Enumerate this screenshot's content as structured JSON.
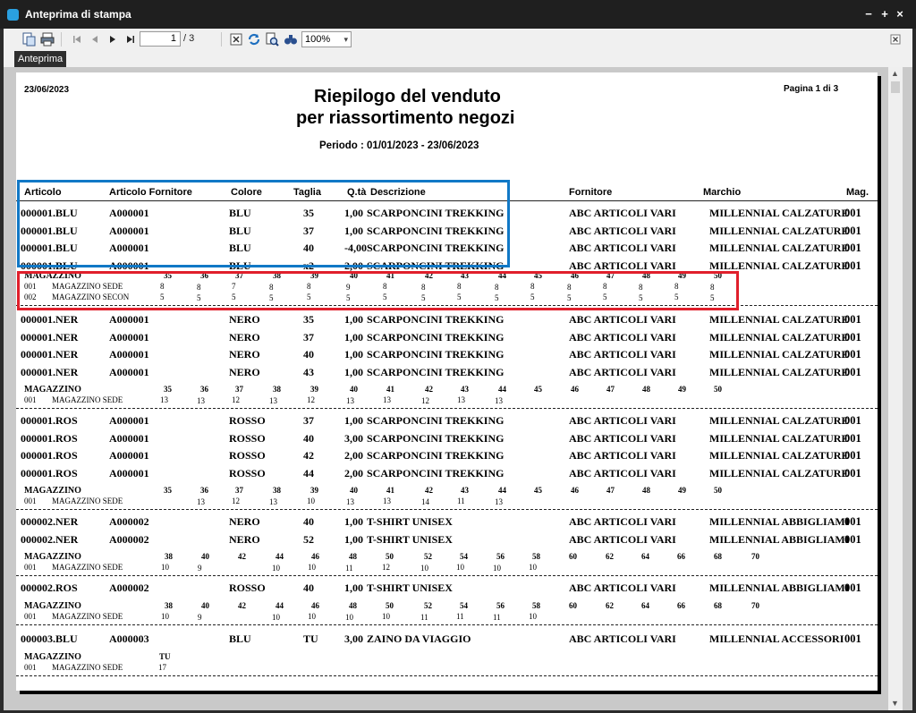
{
  "window": {
    "title": "Anteprima di stampa",
    "controls": [
      "−",
      "+",
      "×"
    ]
  },
  "toolbar": {
    "page_current": "1",
    "page_total": "/ 3",
    "zoom": "100%",
    "tooltip": "Anteprima"
  },
  "report": {
    "date": "23/06/2023",
    "title_line1": "Riepilogo del venduto",
    "title_line2": "per riassortimento negozi",
    "period": "Periodo : 01/01/2023 - 23/06/2023",
    "page_info": "Pagina 1 di 3",
    "headers": {
      "articolo": "Articolo",
      "articolo_fornitore": "Articolo Fornitore",
      "colore": "Colore",
      "taglia": "Taglia",
      "qta": "Q.tà",
      "descrizione": "Descrizione",
      "fornitore": "Fornitore",
      "marchio": "Marchio",
      "mag": "Mag."
    },
    "groups": [
      {
        "rows": [
          {
            "articolo": "000001.BLU",
            "forn_art": "A000001",
            "colore": "BLU",
            "taglia": "35",
            "qta": "1,00",
            "desc": "SCARPONCINI TREKKING",
            "fornitore": "ABC ARTICOLI VARI",
            "marchio": "MILLENNIAL CALZATURE",
            "mag": "001"
          },
          {
            "articolo": "000001.BLU",
            "forn_art": "A000001",
            "colore": "BLU",
            "taglia": "37",
            "qta": "1,00",
            "desc": "SCARPONCINI TREKKING",
            "fornitore": "ABC ARTICOLI VARI",
            "marchio": "MILLENNIAL CALZATURE",
            "mag": "001"
          },
          {
            "articolo": "000001.BLU",
            "forn_art": "A000001",
            "colore": "BLU",
            "taglia": "40",
            "qta": "-4,00",
            "desc": "SCARPONCINI TREKKING",
            "fornitore": "ABC ARTICOLI VARI",
            "marchio": "MILLENNIAL CALZATURE",
            "mag": "001"
          },
          {
            "articolo": "000001.BLU",
            "forn_art": "A000001",
            "colore": "BLU",
            "taglia": "x2",
            "qta": "2,00",
            "desc": "SCARPONCINI TREKKING",
            "fornitore": "ABC ARTICOLI VARI",
            "marchio": "MILLENNIAL CALZATURE",
            "mag": "001"
          }
        ],
        "mag_label": "MAGAZZINO",
        "sizes": [
          "35",
          "36",
          "37",
          "38",
          "39",
          "40",
          "41",
          "42",
          "43",
          "44",
          "45",
          "46",
          "47",
          "48",
          "49",
          "50"
        ],
        "stock": [
          {
            "code": "001",
            "name": "MAGAZZINO SEDE",
            "values": [
              "8",
              "8",
              "7",
              "8",
              "8",
              "9",
              "8",
              "8",
              "8",
              "8",
              "8",
              "8",
              "8",
              "8",
              "8",
              "8"
            ]
          },
          {
            "code": "002",
            "name": "MAGAZZINO SECON",
            "values": [
              "5",
              "5",
              "5",
              "5",
              "5",
              "5",
              "5",
              "5",
              "5",
              "5",
              "5",
              "5",
              "5",
              "5",
              "5",
              "5"
            ]
          }
        ]
      },
      {
        "rows": [
          {
            "articolo": "000001.NER",
            "forn_art": "A000001",
            "colore": "NERO",
            "taglia": "35",
            "qta": "1,00",
            "desc": "SCARPONCINI TREKKING",
            "fornitore": "ABC ARTICOLI VARI",
            "marchio": "MILLENNIAL CALZATURE",
            "mag": "001"
          },
          {
            "articolo": "000001.NER",
            "forn_art": "A000001",
            "colore": "NERO",
            "taglia": "37",
            "qta": "1,00",
            "desc": "SCARPONCINI TREKKING",
            "fornitore": "ABC ARTICOLI VARI",
            "marchio": "MILLENNIAL CALZATURE",
            "mag": "001"
          },
          {
            "articolo": "000001.NER",
            "forn_art": "A000001",
            "colore": "NERO",
            "taglia": "40",
            "qta": "1,00",
            "desc": "SCARPONCINI TREKKING",
            "fornitore": "ABC ARTICOLI VARI",
            "marchio": "MILLENNIAL CALZATURE",
            "mag": "001"
          },
          {
            "articolo": "000001.NER",
            "forn_art": "A000001",
            "colore": "NERO",
            "taglia": "43",
            "qta": "1,00",
            "desc": "SCARPONCINI TREKKING",
            "fornitore": "ABC ARTICOLI VARI",
            "marchio": "MILLENNIAL CALZATURE",
            "mag": "001"
          }
        ],
        "mag_label": "MAGAZZINO",
        "sizes": [
          "35",
          "36",
          "37",
          "38",
          "39",
          "40",
          "41",
          "42",
          "43",
          "44",
          "45",
          "46",
          "47",
          "48",
          "49",
          "50"
        ],
        "stock": [
          {
            "code": "001",
            "name": "MAGAZZINO SEDE",
            "values": [
              "13",
              "13",
              "12",
              "13",
              "12",
              "13",
              "13",
              "12",
              "13",
              "13",
              "",
              "",
              "",
              "",
              "",
              ""
            ]
          }
        ]
      },
      {
        "rows": [
          {
            "articolo": "000001.ROS",
            "forn_art": "A000001",
            "colore": "ROSSO",
            "taglia": "37",
            "qta": "1,00",
            "desc": "SCARPONCINI TREKKING",
            "fornitore": "ABC ARTICOLI VARI",
            "marchio": "MILLENNIAL CALZATURE",
            "mag": "001"
          },
          {
            "articolo": "000001.ROS",
            "forn_art": "A000001",
            "colore": "ROSSO",
            "taglia": "40",
            "qta": "3,00",
            "desc": "SCARPONCINI TREKKING",
            "fornitore": "ABC ARTICOLI VARI",
            "marchio": "MILLENNIAL CALZATURE",
            "mag": "001"
          },
          {
            "articolo": "000001.ROS",
            "forn_art": "A000001",
            "colore": "ROSSO",
            "taglia": "42",
            "qta": "2,00",
            "desc": "SCARPONCINI TREKKING",
            "fornitore": "ABC ARTICOLI VARI",
            "marchio": "MILLENNIAL CALZATURE",
            "mag": "001"
          },
          {
            "articolo": "000001.ROS",
            "forn_art": "A000001",
            "colore": "ROSSO",
            "taglia": "44",
            "qta": "2,00",
            "desc": "SCARPONCINI TREKKING",
            "fornitore": "ABC ARTICOLI VARI",
            "marchio": "MILLENNIAL CALZATURE",
            "mag": "001"
          }
        ],
        "mag_label": "MAGAZZINO",
        "sizes": [
          "35",
          "36",
          "37",
          "38",
          "39",
          "40",
          "41",
          "42",
          "43",
          "44",
          "45",
          "46",
          "47",
          "48",
          "49",
          "50"
        ],
        "stock": [
          {
            "code": "001",
            "name": "MAGAZZINO SEDE",
            "values": [
              "",
              "13",
              "12",
              "13",
              "10",
              "13",
              "13",
              "14",
              "11",
              "13",
              "",
              "",
              "",
              "",
              "",
              ""
            ]
          }
        ]
      },
      {
        "rows": [
          {
            "articolo": "000002.NER",
            "forn_art": "A000002",
            "colore": "NERO",
            "taglia": "40",
            "qta": "1,00",
            "desc": "T-SHIRT UNISEX",
            "fornitore": "ABC ARTICOLI VARI",
            "marchio": "MILLENNIAL ABBIGLIAMI",
            "mag": "001"
          },
          {
            "articolo": "000002.NER",
            "forn_art": "A000002",
            "colore": "NERO",
            "taglia": "52",
            "qta": "1,00",
            "desc": "T-SHIRT UNISEX",
            "fornitore": "ABC ARTICOLI VARI",
            "marchio": "MILLENNIAL ABBIGLIAMI",
            "mag": "001"
          }
        ],
        "mag_label": "MAGAZZINO",
        "sizes": [
          "38",
          "40",
          "42",
          "44",
          "46",
          "48",
          "50",
          "52",
          "54",
          "56",
          "58",
          "60",
          "62",
          "64",
          "66",
          "68",
          "70"
        ],
        "stock": [
          {
            "code": "001",
            "name": "MAGAZZINO SEDE",
            "values": [
              "10",
              "9",
              "",
              "10",
              "10",
              "11",
              "12",
              "10",
              "10",
              "10",
              "10",
              "",
              "",
              "",
              "",
              "",
              ""
            ]
          }
        ]
      },
      {
        "rows": [
          {
            "articolo": "000002.ROS",
            "forn_art": "A000002",
            "colore": "ROSSO",
            "taglia": "40",
            "qta": "1,00",
            "desc": "T-SHIRT UNISEX",
            "fornitore": "ABC ARTICOLI VARI",
            "marchio": "MILLENNIAL ABBIGLIAMI",
            "mag": "001"
          }
        ],
        "mag_label": "MAGAZZINO",
        "sizes": [
          "38",
          "40",
          "42",
          "44",
          "46",
          "48",
          "50",
          "52",
          "54",
          "56",
          "58",
          "60",
          "62",
          "64",
          "66",
          "68",
          "70"
        ],
        "stock": [
          {
            "code": "001",
            "name": "MAGAZZINO SEDE",
            "values": [
              "10",
              "9",
              "",
              "10",
              "10",
              "10",
              "10",
              "11",
              "11",
              "11",
              "10",
              "",
              "",
              "",
              "",
              "",
              ""
            ]
          }
        ]
      },
      {
        "rows": [
          {
            "articolo": "000003.BLU",
            "forn_art": "A000003",
            "colore": "BLU",
            "taglia": "TU",
            "qta": "3,00",
            "desc": "ZAINO DA VIAGGIO",
            "fornitore": "ABC ARTICOLI VARI",
            "marchio": "MILLENNIAL ACCESSORI",
            "mag": "001"
          }
        ],
        "mag_label": "MAGAZZINO",
        "sizes": [
          "TU"
        ],
        "stock": [
          {
            "code": "001",
            "name": "MAGAZZINO SEDE",
            "values": [
              "17"
            ]
          }
        ]
      }
    ]
  },
  "colors": {
    "highlight_blue": "#1178c6",
    "highlight_red": "#e01f2b"
  }
}
